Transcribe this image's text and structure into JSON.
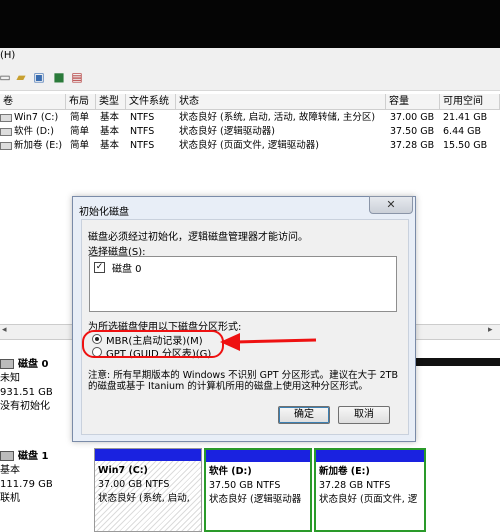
{
  "menu": {
    "help": "(H)"
  },
  "toolbar": {
    "icons": [
      "disk-icon",
      "folder-icon",
      "properties-icon",
      "help-icon"
    ]
  },
  "table": {
    "headers": [
      "卷",
      "布局",
      "类型",
      "文件系统",
      "状态",
      "容量",
      "可用空间"
    ],
    "rows": [
      {
        "name": "Win7 (C:)",
        "layout": "简单",
        "type": "基本",
        "fs": "NTFS",
        "status": "状态良好 (系统, 启动, 活动, 故障转储, 主分区)",
        "capacity": "37.00 GB",
        "free": "21.41 GB"
      },
      {
        "name": "软件 (D:)",
        "layout": "简单",
        "type": "基本",
        "fs": "NTFS",
        "status": "状态良好 (逻辑驱动器)",
        "capacity": "37.50 GB",
        "free": "6.44 GB"
      },
      {
        "name": "新加卷 (E:)",
        "layout": "简单",
        "type": "基本",
        "fs": "NTFS",
        "status": "状态良好 (页面文件, 逻辑驱动器)",
        "capacity": "37.28 GB",
        "free": "15.50 GB"
      }
    ]
  },
  "disks": [
    {
      "name": "磁盘 0",
      "kind": "未知",
      "size": "931.51 GB",
      "state": "没有初始化"
    },
    {
      "name": "磁盘 1",
      "kind": "基本",
      "size": "111.79 GB",
      "state": "联机"
    }
  ],
  "partitions": [
    {
      "name": "Win7  (C:)",
      "size": "37.00 GB NTFS",
      "status": "状态良好 (系统, 启动,"
    },
    {
      "name": "软件  (D:)",
      "size": "37.50 GB NTFS",
      "status": "状态良好 (逻辑驱动器"
    },
    {
      "name": "新加卷  (E:)",
      "size": "37.28 GB NTFS",
      "status": "状态良好 (页面文件, 逻"
    }
  ],
  "dialog": {
    "title": "初始化磁盘",
    "close": "✕",
    "intro": "磁盘必须经过初始化，逻辑磁盘管理器才能访问。",
    "select_label": "选择磁盘(S):",
    "disk_item": "磁盘 0",
    "style_label": "为所选磁盘使用以下磁盘分区形式:",
    "mbr": "MBR(主启动记录)(M)",
    "gpt": "GPT (GUID 分区表)(G)",
    "note": "注意: 所有早期版本的 Windows 不识别 GPT 分区形式。建议在大于 2TB 的磁盘或基于 Itanium 的计算机所用的磁盘上使用这种分区形式。",
    "ok": "确定",
    "cancel": "取消"
  },
  "colors": {
    "partition_bar": "#1a22e0",
    "highlight": "#e11111",
    "selected_border": "#2a9a2a"
  }
}
